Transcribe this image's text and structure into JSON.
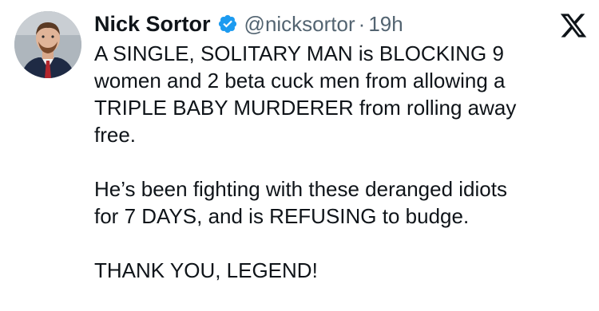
{
  "author": {
    "display_name": "Nick Sortor",
    "handle": "@nicksortor",
    "separator": "·",
    "time": "19h",
    "verified_icon": "verified-badge-icon",
    "avatar_icon": "avatar-photo"
  },
  "platform": {
    "logo_icon": "x-logo-icon"
  },
  "tweet": {
    "paragraphs": [
      "A SINGLE, SOLITARY MAN is BLOCKING 9\nwomen and 2 beta cuck men from allowing a\nTRIPLE BABY MURDERER from rolling away\nfree.",
      "He’s been fighting with these deranged idiots\nfor 7 DAYS, and is REFUSING to budge.",
      "THANK YOU, LEGEND!"
    ]
  },
  "colors": {
    "text": "#0f1419",
    "secondary": "#536471",
    "verified": "#1d9bf0"
  }
}
